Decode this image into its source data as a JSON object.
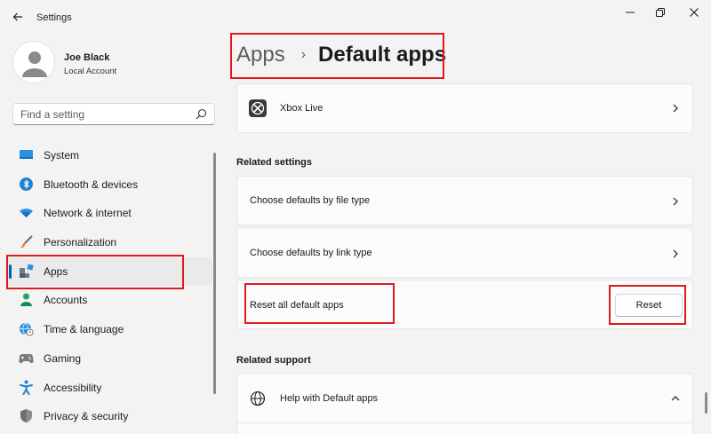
{
  "window": {
    "title": "Settings",
    "controls": [
      "minimize-icon",
      "restore-icon",
      "close-icon"
    ]
  },
  "profile": {
    "name": "Joe Black",
    "account_type": "Local Account"
  },
  "search": {
    "placeholder": "Find a setting",
    "value": ""
  },
  "sidebar": {
    "items": [
      {
        "label": "System",
        "icon": "monitor-icon"
      },
      {
        "label": "Bluetooth & devices",
        "icon": "bluetooth-icon"
      },
      {
        "label": "Network & internet",
        "icon": "wifi-icon"
      },
      {
        "label": "Personalization",
        "icon": "brush-icon"
      },
      {
        "label": "Apps",
        "icon": "apps-icon",
        "selected": true
      },
      {
        "label": "Accounts",
        "icon": "person-icon"
      },
      {
        "label": "Time & language",
        "icon": "globe-clock-icon"
      },
      {
        "label": "Gaming",
        "icon": "gamepad-icon"
      },
      {
        "label": "Accessibility",
        "icon": "accessibility-icon"
      },
      {
        "label": "Privacy & security",
        "icon": "shield-icon"
      }
    ]
  },
  "breadcrumb": {
    "parent": "Apps",
    "separator": "›",
    "current": "Default apps"
  },
  "apps_list": {
    "xbox": "Xbox Live"
  },
  "related_settings": {
    "title": "Related settings",
    "by_file_type": "Choose defaults by file type",
    "by_link_type": "Choose defaults by link type",
    "reset_label": "Reset all default apps",
    "reset_button": "Reset"
  },
  "related_support": {
    "title": "Related support",
    "help": "Help with Default apps"
  },
  "colors": {
    "accent": "#005fb8",
    "highlight": "#e01a1a",
    "background": "#f3f3f3",
    "card": "#fbfbfb"
  }
}
